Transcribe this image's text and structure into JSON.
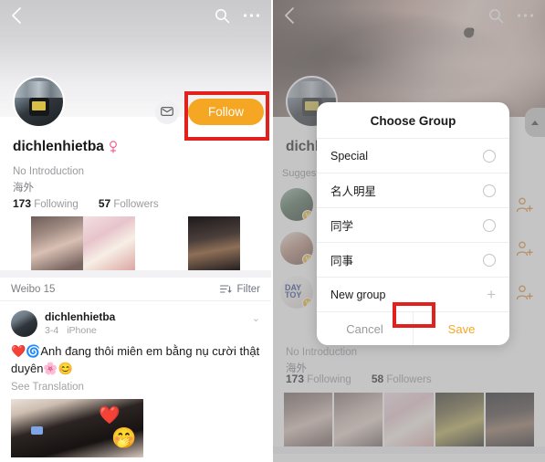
{
  "left_panel": {
    "navbar": {
      "back_icon": "chevron-left-icon",
      "search_icon": "search-icon",
      "more_icon": "more-horizontal-icon"
    },
    "profile": {
      "username": "dichlenhietba",
      "gender_icon": "female-gender-icon",
      "introduction": "No Introduction",
      "location": "海外",
      "following_count": "173",
      "following_label": "Following",
      "followers_count": "57",
      "followers_label": "Followers"
    },
    "actions": {
      "message_icon": "message-envelope-icon",
      "follow_label": "Follow",
      "follow_color": "#f5a623",
      "highlight_color": "#e2211c"
    },
    "weibo_bar": {
      "count_label": "Weibo 15",
      "filter_label": "Filter",
      "filter_icon": "filter-icon"
    },
    "post": {
      "author": "dichlenhietba",
      "date": "3-4",
      "device": "iPhone",
      "expand_icon": "chevron-down-icon",
      "text": "❤️🌀Anh đang thôi miên em bằng nụ cười thật duyên🌸😊",
      "translate_label": "See Translation"
    }
  },
  "right_panel": {
    "navbar": {
      "back_icon": "chevron-left-icon",
      "search_icon": "search-icon",
      "more_icon": "more-horizontal-icon"
    },
    "profile": {
      "username": "dichl",
      "introduction": "No Introduction",
      "location": "海外",
      "following_count": "173",
      "following_label": "Following",
      "followers_count": "58",
      "followers_label": "Followers"
    },
    "suggested_label": "Suggested",
    "suggested_items": [
      {
        "add_icon": "add-user-icon",
        "badge": "V"
      },
      {
        "add_icon": "add-user-icon",
        "badge": "V"
      },
      {
        "add_icon": "add-user-icon",
        "badge": "V",
        "avatar_text": "DAY TOY"
      }
    ],
    "scroll_top_icon": "scroll-to-top-icon",
    "dialog": {
      "title": "Choose Group",
      "options": [
        {
          "label": "Special",
          "control": "radio-unchecked"
        },
        {
          "label": "名人明星",
          "control": "radio-unchecked"
        },
        {
          "label": "同学",
          "control": "radio-unchecked"
        },
        {
          "label": "同事",
          "control": "radio-unchecked"
        },
        {
          "label": "New group",
          "control": "plus-icon"
        }
      ],
      "cancel_label": "Cancel",
      "save_label": "Save",
      "save_color": "#f5a623",
      "highlight_color": "#e2211c"
    }
  }
}
